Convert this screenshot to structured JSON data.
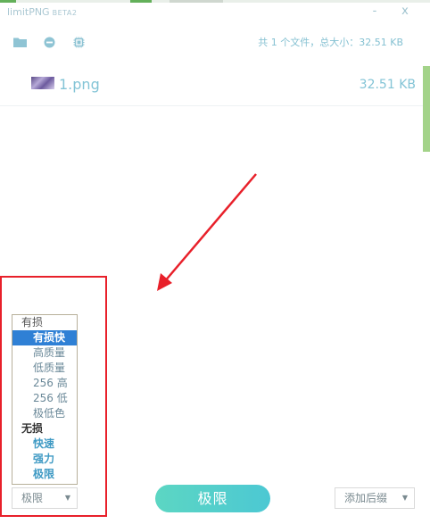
{
  "app": {
    "title": "limitPNG",
    "badge": "BETA2"
  },
  "window": {
    "minimize": "-",
    "close": "x"
  },
  "toolbar": {
    "icons": [
      "folder-icon",
      "minus-circle-icon",
      "chip-icon"
    ],
    "summary": "共 1 个文件，总大小：32.51 KB"
  },
  "files": [
    {
      "name": "1.png",
      "size": "32.51 KB"
    }
  ],
  "mode_list": {
    "group_lossy": "有损",
    "lossy_options": [
      "有损快",
      "高质量",
      "低质量",
      "256 高",
      "256 低",
      "极低色"
    ],
    "selected": "有损快",
    "group_lossless": "无损",
    "lossless_options": [
      "快速",
      "强力",
      "极限"
    ]
  },
  "mode_select": {
    "value": "极限"
  },
  "compress_button": {
    "label": "极限"
  },
  "suffix_select": {
    "value": "添加后缀"
  },
  "colors": {
    "accent": "#4cc8d3",
    "selection": "#2f80d5",
    "annotation": "#e8202a"
  }
}
